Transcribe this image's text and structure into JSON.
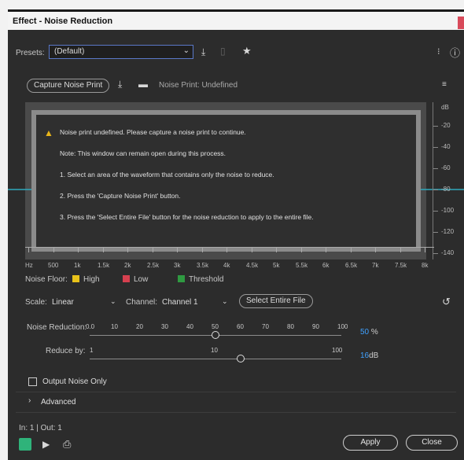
{
  "window": {
    "title": "Effect - Noise Reduction"
  },
  "presets": {
    "label": "Presets:",
    "value": "(Default)"
  },
  "noise_print": {
    "capture_label": "Capture Noise Print",
    "status": "Noise Print: Undefined"
  },
  "warning": {
    "line1": "Noise print undefined. Please capture a noise print to continue.",
    "note": "Note: This window can remain open during this process.",
    "step1": "1. Select an area of the waveform that contains only the noise to reduce.",
    "step2": "2. Press the 'Capture Noise Print' button.",
    "step3": "3. Press the 'Select Entire File' button for the noise reduction to apply to the entire file."
  },
  "db_scale": {
    "unit": "dB",
    "labels": [
      "-20",
      "-40",
      "-60",
      "-80",
      "-100",
      "-120",
      "-140"
    ]
  },
  "freq_axis": {
    "labels": [
      "Hz",
      "500",
      "1k",
      "1.5k",
      "2k",
      "2.5k",
      "3k",
      "3.5k",
      "4k",
      "4.5k",
      "5k",
      "5.5k",
      "6k",
      "6.5k",
      "7k",
      "7.5k",
      "8k"
    ]
  },
  "legend": {
    "label": "Noise Floor:",
    "items": [
      {
        "label": "High",
        "color": "#e8c21a"
      },
      {
        "label": "Low",
        "color": "#d6404f"
      },
      {
        "label": "Threshold",
        "color": "#2f9a41"
      }
    ]
  },
  "scale": {
    "label": "Scale:",
    "value": "Linear"
  },
  "channel": {
    "label": "Channel:",
    "value": "Channel 1"
  },
  "select_entire_file_label": "Select Entire File",
  "noise_reduction": {
    "label": "Noise Reduction:",
    "ticks": [
      "0.0",
      "10",
      "20",
      "30",
      "40",
      "50",
      "60",
      "70",
      "80",
      "90",
      "100"
    ],
    "value": "50",
    "unit": "%",
    "level": 0.5
  },
  "reduce_by": {
    "label": "Reduce by:",
    "ticks": [
      "1",
      "10",
      "100"
    ],
    "value": "16",
    "unit": "dB",
    "level": 0.6
  },
  "output_noise_only": {
    "label": "Output Noise Only",
    "checked": false
  },
  "advanced": {
    "label": "Advanced"
  },
  "io": {
    "label": "In: 1 | Out: 1"
  },
  "buttons": {
    "apply": "Apply",
    "close": "Close"
  },
  "colors": {
    "accent": "#3fa1ff",
    "power_on": "#2fb37a"
  }
}
